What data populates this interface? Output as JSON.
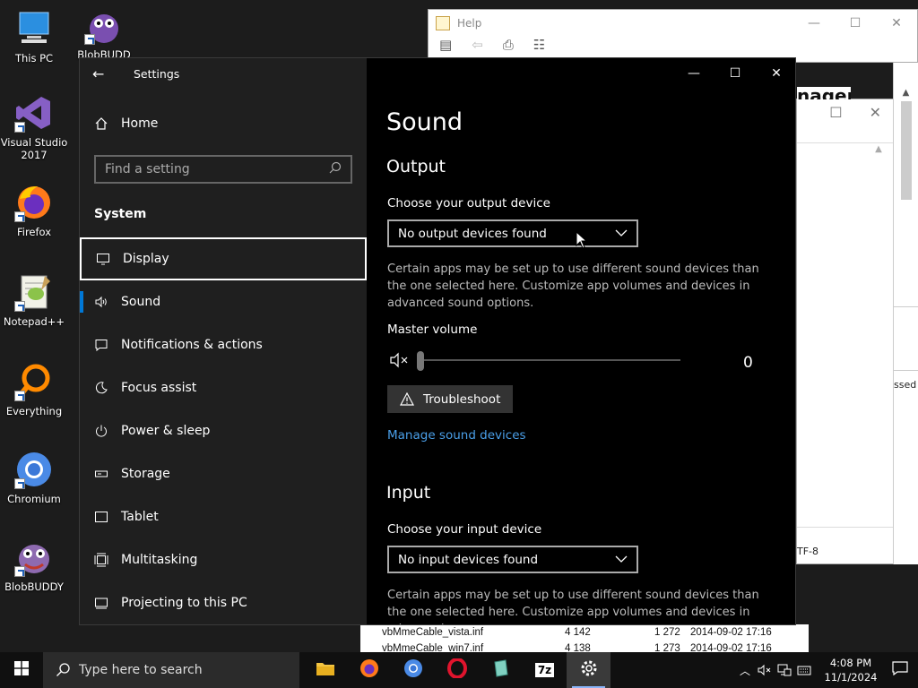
{
  "desktop": {
    "icons": [
      {
        "label": "This PC",
        "icon": "this-pc-icon"
      },
      {
        "label": "BlobBUDD",
        "icon": "blobbuddy-icon"
      },
      {
        "label": "Visual Studio 2017",
        "icon": "visual-studio-icon"
      },
      {
        "label": "Firefox",
        "icon": "firefox-icon"
      },
      {
        "label": "Notepad++",
        "icon": "notepadpp-icon"
      },
      {
        "label": "Everything",
        "icon": "everything-icon"
      },
      {
        "label": "Chromium",
        "icon": "chromium-icon"
      },
      {
        "label": "BlobBUDDY",
        "icon": "blobbuddy-icon"
      }
    ]
  },
  "help_window": {
    "title": "Help"
  },
  "manager_window": {
    "title_fragment": "nager",
    "status_fragment": "TF-8",
    "side_fragment": "ssed"
  },
  "file_list": {
    "rows": [
      {
        "name": "vbMmeCable_vista.inf",
        "size": "4 142",
        "packed": "1 272",
        "date": "2014-09-02 17:16"
      },
      {
        "name": "vbMmeCable_win7.inf",
        "size": "4 138",
        "packed": "1 273",
        "date": "2014-09-02 17:16"
      }
    ]
  },
  "settings": {
    "window_title": "Settings",
    "home_label": "Home",
    "search_placeholder": "Find a setting",
    "section_title": "System",
    "nav_items": [
      {
        "label": "Display",
        "icon": "display-icon"
      },
      {
        "label": "Sound",
        "icon": "sound-icon"
      },
      {
        "label": "Notifications & actions",
        "icon": "notifications-icon"
      },
      {
        "label": "Focus assist",
        "icon": "focus-assist-icon"
      },
      {
        "label": "Power & sleep",
        "icon": "power-icon"
      },
      {
        "label": "Storage",
        "icon": "storage-icon"
      },
      {
        "label": "Tablet",
        "icon": "tablet-icon"
      },
      {
        "label": "Multitasking",
        "icon": "multitasking-icon"
      },
      {
        "label": "Projecting to this PC",
        "icon": "projecting-icon"
      }
    ],
    "selected_item": "Sound",
    "focused_item": "Display",
    "page": {
      "title": "Sound",
      "output_heading": "Output",
      "output_device_label": "Choose your output device",
      "output_device_value": "No output devices found",
      "output_desc": "Certain apps may be set up to use different sound devices than the one selected here. Customize app volumes and devices in advanced sound options.",
      "master_volume_label": "Master volume",
      "master_volume_value": "0",
      "troubleshoot_label": "Troubleshoot",
      "manage_link": "Manage sound devices",
      "input_heading": "Input",
      "input_device_label": "Choose your input device",
      "input_device_value": "No input devices found",
      "input_desc": "Certain apps may be set up to use different sound devices than the one selected here. Customize app volumes and devices in advanced"
    }
  },
  "taskbar": {
    "search_placeholder": "Type here to search",
    "apps": [
      "file-explorer-icon",
      "firefox-icon",
      "chromium-icon",
      "opera-icon",
      "notepadpp-icon",
      "7zip-icon",
      "settings-icon"
    ],
    "sevenzip_label": "7z",
    "time": "4:08 PM",
    "date": "11/1/2024"
  },
  "colors": {
    "accent": "#0078d7",
    "link": "#4a9fe8"
  }
}
